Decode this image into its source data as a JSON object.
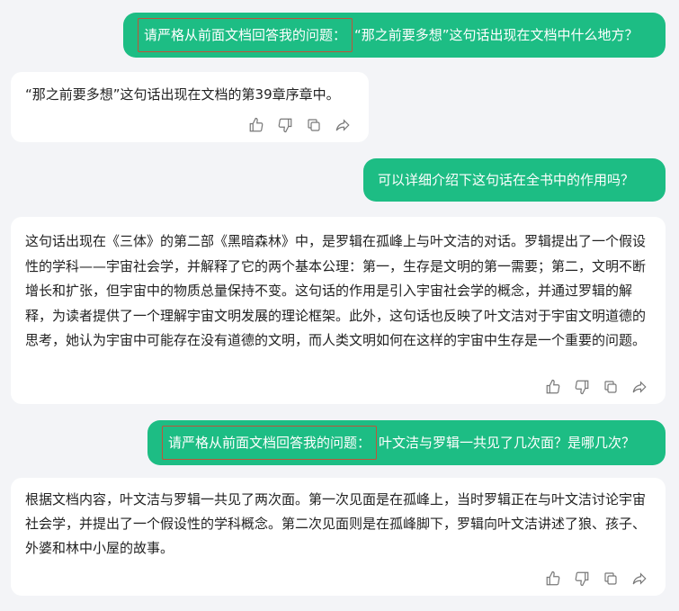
{
  "conversation": {
    "msg1": {
      "highlight": "请严格从前面文档回答我的问题：",
      "text": "“那之前要多想”这句话出现在文档中什么地方？"
    },
    "reply1": {
      "text": "“那之前要多想”这句话出现在文档的第39章序章中。"
    },
    "msg2": {
      "text": "可以详细介绍下这句话在全书中的作用吗？"
    },
    "reply2": {
      "text": "这句话出现在《三体》的第二部《黑暗森林》中，是罗辑在孤峰上与叶文洁的对话。罗辑提出了一个假设性的学科——宇宙社会学，并解释了它的两个基本公理：第一，生存是文明的第一需要；第二，文明不断增长和扩张，但宇宙中的物质总量保持不变。这句话的作用是引入宇宙社会学的概念，并通过罗辑的解释，为读者提供了一个理解宇宙文明发展的理论框架。此外，这句话也反映了叶文洁对于宇宙文明道德的思考，她认为宇宙中可能存在没有道德的文明，而人类文明如何在这样的宇宙中生存是一个重要的问题。"
    },
    "msg3": {
      "highlight": "请严格从前面文档回答我的问题：",
      "text": "叶文洁与罗辑一共见了几次面？是哪几次？"
    },
    "reply3": {
      "text": "根据文档内容，叶文洁与罗辑一共见了两次面。第一次见面是在孤峰上，当时罗辑正在与叶文洁讨论宇宙社会学，并提出了一个假设性的学科概念。第二次见面则是在孤峰脚下，罗辑向叶文洁讲述了狼、孩子、外婆和林中小屋的故事。"
    }
  },
  "icons": [
    "thumbs-up-icon",
    "thumbs-down-icon",
    "copy-icon",
    "share-icon"
  ],
  "colors": {
    "user_bubble": "#1dbd84",
    "highlight_border": "#c0533a",
    "background": "#f3f4f7",
    "card": "#ffffff"
  }
}
